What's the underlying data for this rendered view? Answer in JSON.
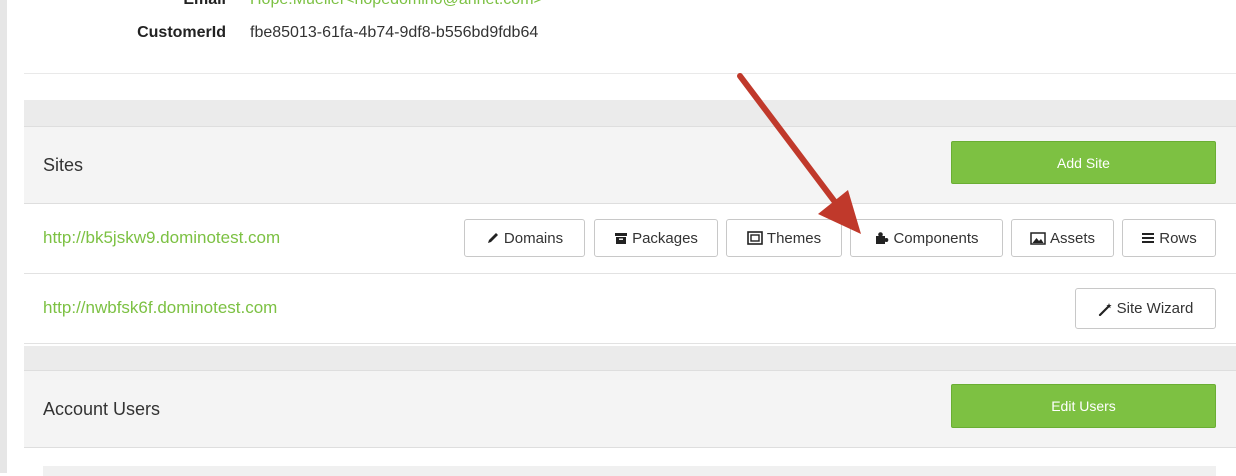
{
  "customer": {
    "email_label": "Email",
    "email_value": "Hope.Mueller<hopedomino@ahnet.com>",
    "customerid_label": "CustomerId",
    "customerid_value": "fbe85013-61fa-4b74-9df8-b556bd9fdb64"
  },
  "sites": {
    "title": "Sites",
    "add_label": "Add Site",
    "rows": [
      {
        "url": "http://bk5jskw9.dominotest.com",
        "buttons": [
          "Domains",
          "Packages",
          "Themes",
          "Components",
          "Assets",
          "Rows"
        ]
      },
      {
        "url": "http://nwbfsk6f.dominotest.com",
        "buttons": [
          "Site Wizard"
        ]
      }
    ]
  },
  "account_users": {
    "title": "Account Users",
    "edit_label": "Edit Users"
  },
  "colors": {
    "accent_green": "#7dc142",
    "link_green": "#7cc143",
    "annotation_arrow": "#c0392b"
  },
  "icons": [
    "pencil-icon",
    "archive-box-icon",
    "frame-icon",
    "puzzle-icon",
    "image-icon",
    "list-icon",
    "magic-wand-icon"
  ]
}
